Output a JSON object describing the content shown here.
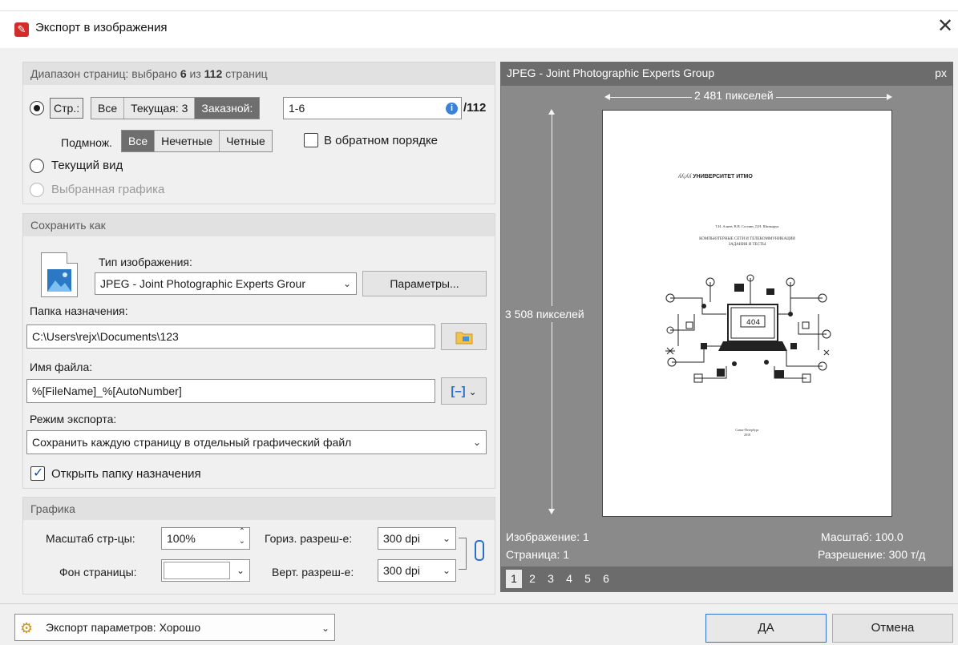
{
  "window": {
    "title": "Экспорт в изображения"
  },
  "range": {
    "header_prefix": "Диапазон страниц: выбрано",
    "header_selected": "6",
    "header_of": "из",
    "header_total": "112",
    "header_suffix": "страниц",
    "pages_radio_label": "Стр.:",
    "mode_all": "Все",
    "mode_current": "Текущая: 3",
    "mode_custom": "Заказной:",
    "custom_value": "1-6",
    "total": "/112",
    "subset_label": "Подмнож.",
    "subset_all": "Все",
    "subset_odd": "Нечетные",
    "subset_even": "Четные",
    "reverse_label": "В обратном порядке",
    "current_view_label": "Текущий вид",
    "selected_graphics_label": "Выбранная графика"
  },
  "save": {
    "header": "Сохранить как",
    "type_label": "Тип изображения:",
    "type_value": "JPEG - Joint Photographic Experts Grour",
    "params_button": "Параметры...",
    "folder_label": "Папка назначения:",
    "folder_value": "C:\\Users\\rejx\\Documents\\123",
    "filename_label": "Имя файла:",
    "filename_value": "%[FileName]_%[AutoNumber]",
    "export_mode_label": "Режим экспорта:",
    "export_mode_value": "Сохранить каждую страницу в отдельный графический файл",
    "open_folder_label": "Открыть папку назначения"
  },
  "graphics": {
    "header": "Графика",
    "scale_label": "Масштаб стр-цы:",
    "scale_value": "100%",
    "bg_label": "Фон страницы:",
    "hres_label": "Гориз. разреш-е:",
    "hres_value": "300 dpi",
    "vres_label": "Верт. разреш-е:",
    "vres_value": "300 dpi"
  },
  "preview": {
    "header": "JPEG - Joint Photographic Experts Group",
    "unit": "px",
    "width_label": "2 481 пикселей",
    "height_label": "3 508 пикселей",
    "image_info": "Изображение: 1",
    "page_info": "Страница: 1",
    "scale_info": "Масштаб: 100.0",
    "resolution_info": "Разрешение: 300 т/д",
    "pages": [
      "1",
      "2",
      "3",
      "4",
      "5",
      "6"
    ],
    "doc": {
      "university": "УНИВЕРСИТЕТ ИТМО",
      "authors": "Т.И. Алиев, В.В. Соснин, Д.Н. Шинкарук",
      "title_line1": "КОМПЬЮТЕРНЫЕ СЕТИ И ТЕЛЕКОММУНИКАЦИИ",
      "title_line2": "ЗАДАНИЯ И ТЕСТЫ",
      "error_code": "404",
      "city": "Санкт-Петербург",
      "year": "2018"
    }
  },
  "footer": {
    "preset_label": "Экспорт параметров: Хорошо",
    "ok_button": "ДА",
    "cancel_button": "Отмена"
  }
}
